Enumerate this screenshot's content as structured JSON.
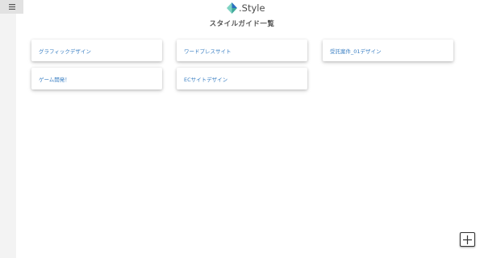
{
  "app": {
    "logo_text": ".Style",
    "page_title": "スタイルガイド一覧"
  },
  "icons": {
    "menu": "hamburger-menu-icon",
    "logo": "diamond-logo-icon",
    "add": "plus-icon"
  },
  "colors": {
    "card_label": "#3a7fc3",
    "logo_light": "#7ed3c2",
    "logo_dark": "#2a6fc0"
  },
  "cards": [
    {
      "label": "グラフィックデザイン"
    },
    {
      "label": "ワードプレスサイト"
    },
    {
      "label": "受託案件_01デザイン"
    },
    {
      "label": "ゲーム開発！"
    },
    {
      "label": "ECサイトデザイン"
    }
  ]
}
